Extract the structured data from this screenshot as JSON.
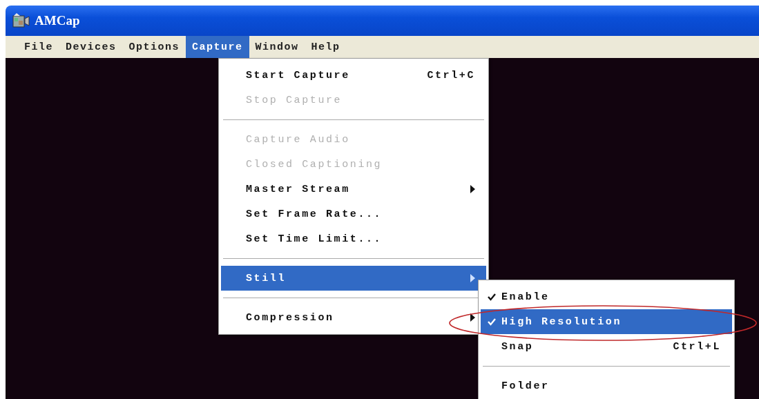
{
  "window": {
    "title": "AMCap"
  },
  "menu_bar": [
    {
      "label": "File",
      "selected": false
    },
    {
      "label": "Devices",
      "selected": false
    },
    {
      "label": "Options",
      "selected": false
    },
    {
      "label": "Capture",
      "selected": true
    },
    {
      "label": "Window",
      "selected": false
    },
    {
      "label": "Help",
      "selected": false
    }
  ],
  "capture_menu": [
    {
      "kind": "item",
      "label": "Start Capture",
      "shortcut": "Ctrl+C",
      "disabled": false,
      "selected": false
    },
    {
      "kind": "item",
      "label": "Stop Capture",
      "disabled": true,
      "selected": false
    },
    {
      "kind": "separator"
    },
    {
      "kind": "item",
      "label": "Capture Audio",
      "disabled": true,
      "selected": false
    },
    {
      "kind": "item",
      "label": "Closed Captioning",
      "disabled": true,
      "selected": false
    },
    {
      "kind": "submenu",
      "label": "Master Stream",
      "disabled": false,
      "selected": false
    },
    {
      "kind": "item",
      "label": "Set Frame Rate...",
      "disabled": false,
      "selected": false
    },
    {
      "kind": "item",
      "label": "Set Time Limit...",
      "disabled": false,
      "selected": false
    },
    {
      "kind": "separator"
    },
    {
      "kind": "submenu",
      "label": "Still",
      "disabled": false,
      "selected": true
    },
    {
      "kind": "separator"
    },
    {
      "kind": "submenu",
      "label": "Compression",
      "disabled": false,
      "selected": false
    }
  ],
  "still_submenu": [
    {
      "kind": "item",
      "label": "Enable",
      "checked": true,
      "selected": false
    },
    {
      "kind": "item",
      "label": "High Resolution",
      "checked": true,
      "selected": true
    },
    {
      "kind": "item",
      "label": "Snap",
      "shortcut": "Ctrl+L",
      "checked": false,
      "selected": false
    },
    {
      "kind": "separator"
    },
    {
      "kind": "item",
      "label": "Folder",
      "checked": false,
      "selected": false
    }
  ],
  "annotation": {
    "kind": "ellipse"
  }
}
